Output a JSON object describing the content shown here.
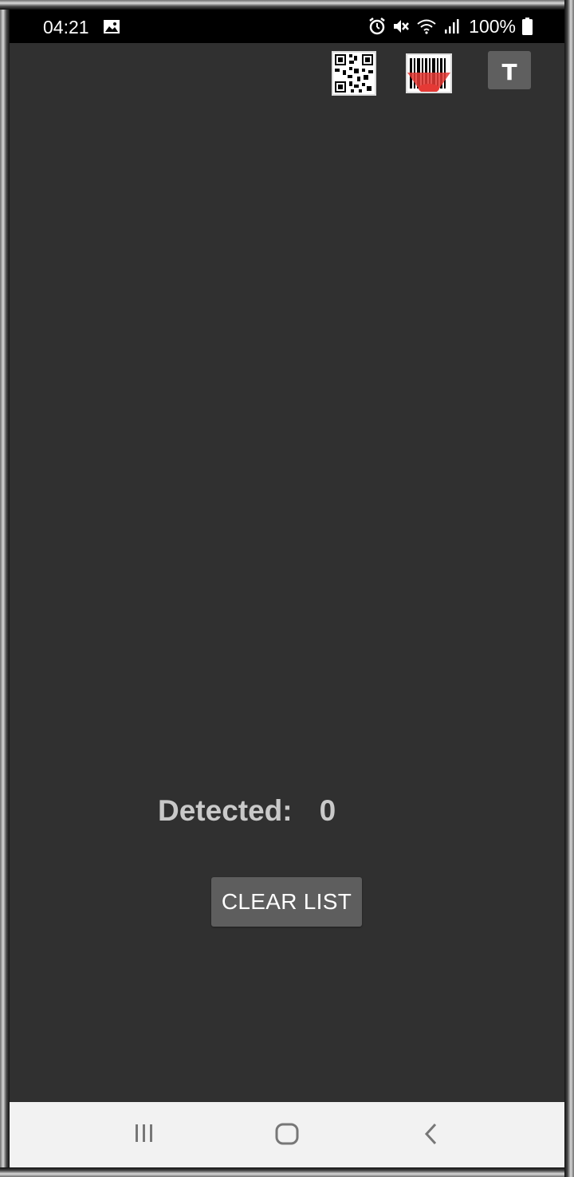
{
  "status_bar": {
    "time": "04:21",
    "battery": "100%",
    "icons": [
      "gallery-icon",
      "alarm-icon",
      "mute-icon",
      "wifi-icon",
      "signal-icon",
      "battery-icon"
    ]
  },
  "toolbar": {
    "qr_icon": "qr-code-icon",
    "barcode_icon": "barcode-scan-icon",
    "text_button_label": "T"
  },
  "main": {
    "detected_label": "Detected:",
    "detected_count": "0",
    "clear_button_label": "CLEAR LIST"
  },
  "nav_bar": {
    "icons": [
      "recents-icon",
      "home-icon",
      "back-icon"
    ]
  },
  "colors": {
    "background": "#303030",
    "button": "#5e5e5e",
    "label": "#c9c9c9",
    "barcode_laser": "#e53935"
  }
}
